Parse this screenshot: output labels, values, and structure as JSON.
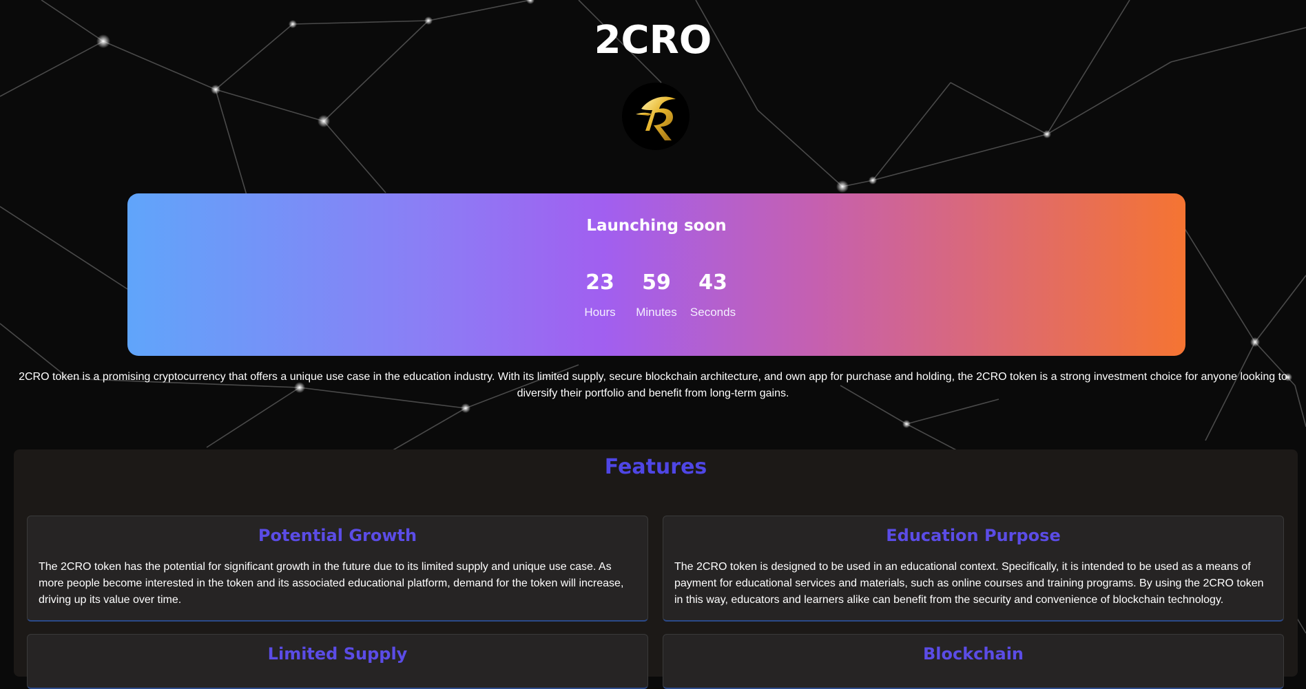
{
  "header": {
    "title": "2CRO",
    "logo": "2cro-logo-icon"
  },
  "countdown": {
    "heading": "Launching soon",
    "units": [
      {
        "value": "23",
        "label": "Hours"
      },
      {
        "value": "59",
        "label": "Minutes"
      },
      {
        "value": "43",
        "label": "Seconds"
      }
    ]
  },
  "description": "2CRO token is a promising cryptocurrency that offers a unique use case in the education industry. With its limited supply, secure blockchain architecture, and own app for purchase and holding, the 2CRO token is a strong investment choice for anyone looking to diversify their portfolio and benefit from long-term gains.",
  "features": {
    "title": "Features",
    "items": [
      {
        "title": "Potential Growth",
        "text": "The 2CRO token has the potential for significant growth in the future due to its limited supply and unique use case. As more people become interested in the token and its associated educational platform, demand for the token will increase, driving up its value over time."
      },
      {
        "title": "Education Purpose",
        "text": "The 2CRO token is designed to be used in an educational context. Specifically, it is intended to be used as a means of payment for educational services and materials, such as online courses and training programs. By using the 2CRO token in this way, educators and learners alike can benefit from the security and convenience of blockchain technology."
      },
      {
        "title": "Limited Supply",
        "text": ""
      },
      {
        "title": "Blockchain",
        "text": ""
      }
    ]
  },
  "colors": {
    "accent": "#4f46e5",
    "gradient_start": "#60a5fa",
    "gradient_mid": "#a15ff0",
    "gradient_end": "#f57432",
    "panel": "#1c1917"
  }
}
